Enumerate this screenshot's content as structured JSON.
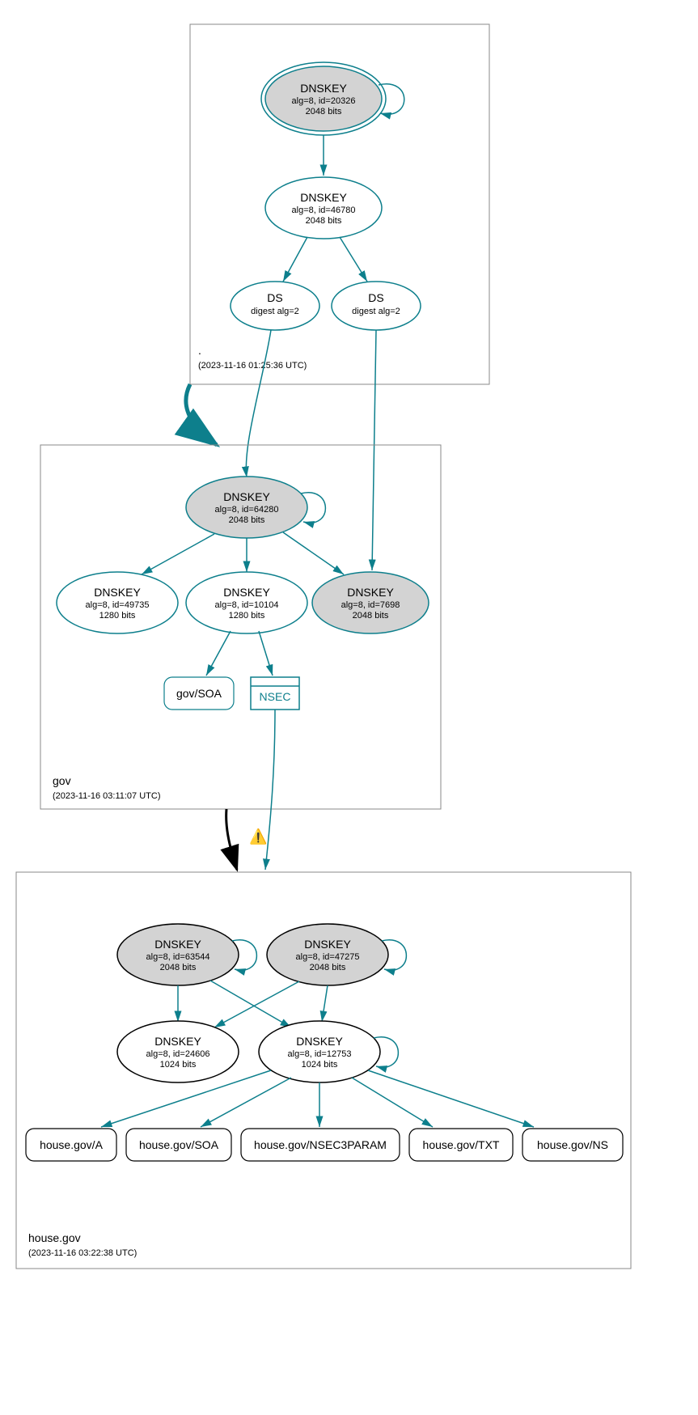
{
  "zones": {
    "root": {
      "label": ".",
      "timestamp": "(2023-11-16 01:25:36 UTC)",
      "nodes": {
        "ksk": {
          "title": "DNSKEY",
          "line2": "alg=8, id=20326",
          "line3": "2048 bits"
        },
        "zsk": {
          "title": "DNSKEY",
          "line2": "alg=8, id=46780",
          "line3": "2048 bits"
        },
        "ds1": {
          "title": "DS",
          "line2": "digest alg=2"
        },
        "ds2": {
          "title": "DS",
          "line2": "digest alg=2"
        }
      }
    },
    "gov": {
      "label": "gov",
      "timestamp": "(2023-11-16 03:11:07 UTC)",
      "nodes": {
        "ksk": {
          "title": "DNSKEY",
          "line2": "alg=8, id=64280",
          "line3": "2048 bits"
        },
        "zsk1": {
          "title": "DNSKEY",
          "line2": "alg=8, id=49735",
          "line3": "1280 bits"
        },
        "zsk2": {
          "title": "DNSKEY",
          "line2": "alg=8, id=10104",
          "line3": "1280 bits"
        },
        "ksk2": {
          "title": "DNSKEY",
          "line2": "alg=8, id=7698",
          "line3": "2048 bits"
        },
        "soa": {
          "label": "gov/SOA"
        },
        "nsec": {
          "label": "NSEC"
        }
      }
    },
    "house": {
      "label": "house.gov",
      "timestamp": "(2023-11-16 03:22:38 UTC)",
      "nodes": {
        "ksk1": {
          "title": "DNSKEY",
          "line2": "alg=8, id=63544",
          "line3": "2048 bits"
        },
        "ksk2": {
          "title": "DNSKEY",
          "line2": "alg=8, id=47275",
          "line3": "2048 bits"
        },
        "zsk1": {
          "title": "DNSKEY",
          "line2": "alg=8, id=24606",
          "line3": "1024 bits"
        },
        "zsk2": {
          "title": "DNSKEY",
          "line2": "alg=8, id=12753",
          "line3": "1024 bits"
        },
        "rr_a": {
          "label": "house.gov/A"
        },
        "rr_soa": {
          "label": "house.gov/SOA"
        },
        "rr_nsec3p": {
          "label": "house.gov/NSEC3PARAM"
        },
        "rr_txt": {
          "label": "house.gov/TXT"
        },
        "rr_ns": {
          "label": "house.gov/NS"
        }
      }
    }
  },
  "warning_icon": "⚠"
}
